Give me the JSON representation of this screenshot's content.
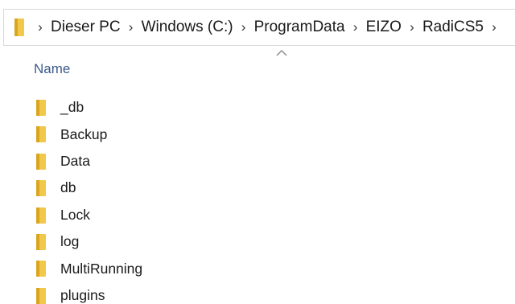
{
  "breadcrumb": {
    "items": [
      {
        "label": "Dieser PC"
      },
      {
        "label": "Windows (C:)"
      },
      {
        "label": "ProgramData"
      },
      {
        "label": "EIZO"
      },
      {
        "label": "RadiCS5"
      }
    ],
    "separator": "›",
    "folder_icon_color": "#f4c842"
  },
  "list": {
    "column_header": "Name",
    "sort_indicator": "sort-ascending",
    "folders": [
      {
        "name": "_db"
      },
      {
        "name": "Backup"
      },
      {
        "name": "Data"
      },
      {
        "name": "db"
      },
      {
        "name": "Lock"
      },
      {
        "name": "log"
      },
      {
        "name": "MultiRunning"
      },
      {
        "name": "plugins"
      }
    ]
  },
  "colors": {
    "folder": "#f2c84b",
    "folder_dark": "#d9a520",
    "header_text": "#3c5a8a"
  }
}
